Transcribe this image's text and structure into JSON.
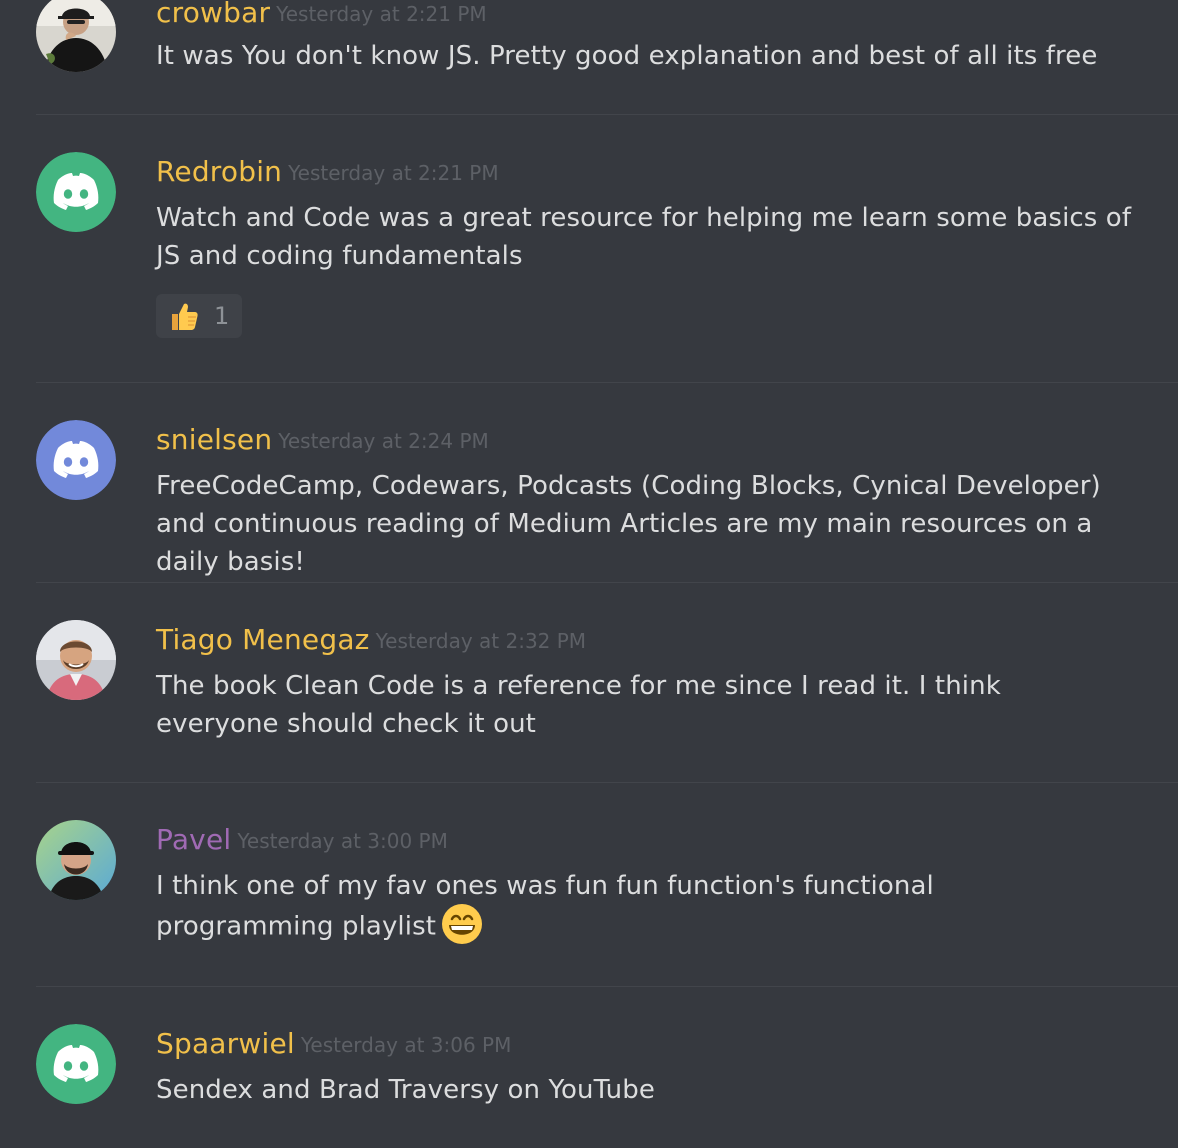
{
  "colors": {
    "background": "#36393f",
    "author_default": "#f1c04a",
    "author_pavel": "#a06ab4",
    "timestamp": "#5d6066",
    "text": "#dcddde",
    "divider": "#42454b",
    "discord_green": "#43b581",
    "discord_blue": "#7289da"
  },
  "messages": [
    {
      "author": "crowbar",
      "timestamp": "Yesterday at 2:21 PM",
      "avatar": "photo-avatar",
      "text": "It was You don't know JS. Pretty good explanation and best of all its free"
    },
    {
      "author": "Redrobin",
      "timestamp": "Yesterday at 2:21 PM",
      "avatar": "discord-default-avatar-green",
      "text": "Watch and Code was a great resource for helping me learn some basics of JS and coding fundamentals",
      "reaction": {
        "emoji": "thumbs-up-icon",
        "count": "1"
      }
    },
    {
      "author": "snielsen",
      "timestamp": "Yesterday at 2:24 PM",
      "avatar": "discord-default-avatar-blue",
      "text": "FreeCodeCamp, Codewars, Podcasts (Coding Blocks, Cynical Developer) and continuous reading of Medium Articles are my main resources on a daily basis!"
    },
    {
      "author": "Tiago Menegaz",
      "timestamp": "Yesterday at 2:32 PM",
      "avatar": "photo-avatar",
      "text": "The book Clean Code is a reference for me since I read it. I think everyone should check it out"
    },
    {
      "author": "Pavel",
      "timestamp": "Yesterday at 3:00 PM",
      "avatar": "photo-avatar",
      "text": "I think one of my fav ones was fun fun function's functional programming playlist",
      "inline_emoji": "grinning-face-icon"
    },
    {
      "author": "Spaarwiel",
      "timestamp": "Yesterday at 3:06 PM",
      "avatar": "discord-default-avatar-green",
      "text": "Sendex and Brad Traversy on YouTube"
    }
  ]
}
